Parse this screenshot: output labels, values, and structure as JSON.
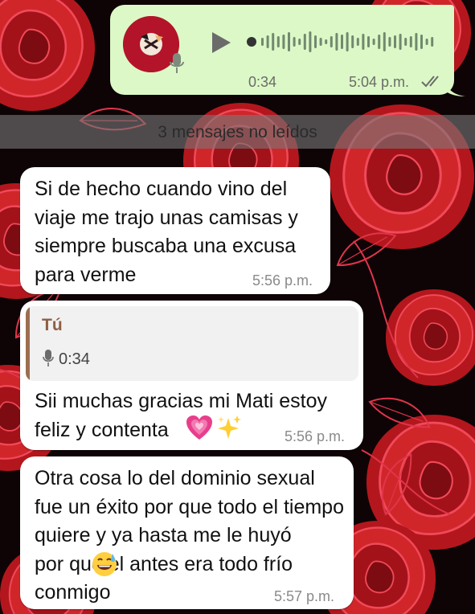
{
  "colors": {
    "wallpaper": "#0e0406",
    "rose_fill": "#c51f24",
    "rose_outline": "#e0354a",
    "incoming_bubble": "#ffffff",
    "outgoing_bubble": "#dcf8c6",
    "quote_bar": "#9c6d4f",
    "quote_author": "#8e5f45"
  },
  "voice_note": {
    "duration": "0:34",
    "time": "5:04 p.m.",
    "status_icon": "double-check-icon",
    "play_icon": "play-icon",
    "progress": 0.0
  },
  "unread_banner": "3 mensajes no leídos",
  "messages": [
    {
      "text": "Si de hecho cuando vino del viaje me trajo unas camisas y siempre buscaba una excusa para verme",
      "time": "5:56 p.m."
    },
    {
      "reply_to": {
        "author": "Tú",
        "duration": "0:34",
        "icon": "mic-icon"
      },
      "text": "Sii muchas gracias mi Mati estoy feliz y contenta",
      "emojis": [
        "growing-heart-emoji",
        "sparkles-emoji"
      ],
      "time": "5:56 p.m."
    },
    {
      "text_part1": "Otra cosa lo del dominio sexual fue un éxito por que todo el tiempo quiere y ya hasta me le huyó",
      "emoji": "grinning-sweat-emoji",
      "text_part2": "por que el antes era todo frío conmigo",
      "time": "5:57 p.m."
    }
  ]
}
